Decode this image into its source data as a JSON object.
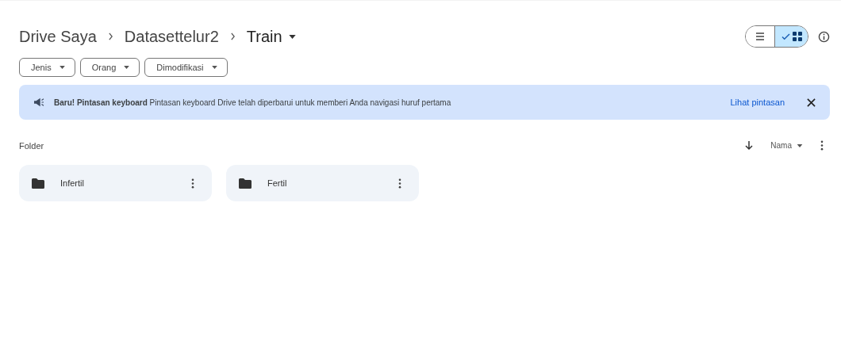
{
  "breadcrumbs": [
    {
      "label": "Drive Saya",
      "current": false
    },
    {
      "label": "Datasettelur2",
      "current": false
    },
    {
      "label": "Train",
      "current": true
    }
  ],
  "view_toggle": [
    {
      "kind": "list",
      "selected": false
    },
    {
      "kind": "grid",
      "selected": true
    }
  ],
  "filters": [
    {
      "label": "Jenis"
    },
    {
      "label": "Orang"
    },
    {
      "label": "Dimodifikasi"
    }
  ],
  "banner": {
    "text": "**Baru! Pintasan keyboard** Pintasan keyboard Drive telah diperbarui untuk memberi Anda navigasi huruf pertama",
    "action": "Lihat pintasan"
  },
  "section": {
    "title": "Folder",
    "sort_label": "Nama"
  },
  "folders": [
    {
      "name": "Infertil"
    },
    {
      "name": "Fertil"
    }
  ]
}
